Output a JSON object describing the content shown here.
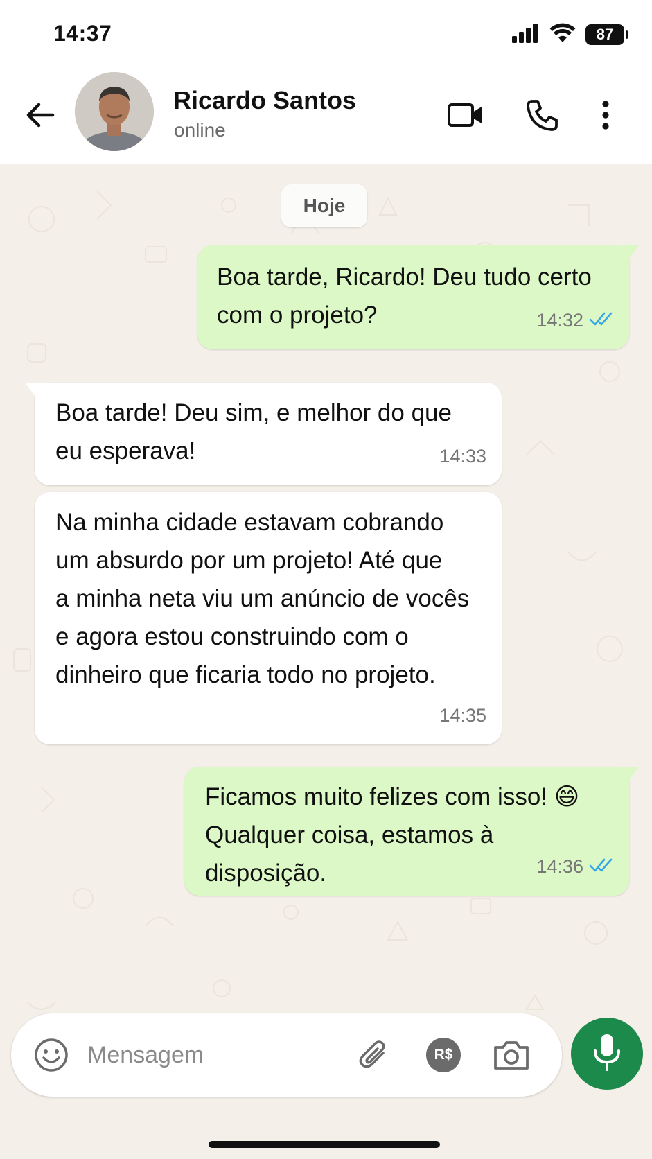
{
  "status_bar": {
    "time": "14:37",
    "battery": "87",
    "icons": [
      "signal-icon",
      "wifi-icon",
      "battery-icon"
    ]
  },
  "header": {
    "contact_name": "Ricardo Santos",
    "contact_status": "online",
    "icons": [
      "back-arrow-icon",
      "video-call-icon",
      "phone-icon",
      "more-options-icon"
    ]
  },
  "chat": {
    "date_label": "Hoje",
    "messages": [
      {
        "direction": "out",
        "text": "Boa tarde, Ricardo! Deu tudo certo\ncom o projeto?",
        "time": "14:32",
        "read": true
      },
      {
        "direction": "in",
        "text": "Boa tarde! Deu sim, e melhor do que\neu esperava!",
        "time": "14:33"
      },
      {
        "direction": "in",
        "text": "Na minha cidade estavam cobrando\num absurdo por um projeto! Até que\na minha neta viu um anúncio de vocês\ne agora estou construindo com o\ndinheiro que ficaria todo no projeto.",
        "time": "14:35"
      },
      {
        "direction": "out",
        "text": "Ficamos muito felizes com isso! 😄\nQualquer coisa, estamos à disposição.",
        "time": "14:36",
        "read": true
      }
    ]
  },
  "input": {
    "placeholder": "Mensagem",
    "payment_icon_label": "R$",
    "icons": [
      "emoji-icon",
      "attach-icon",
      "payment-icon",
      "camera-icon",
      "mic-icon"
    ]
  },
  "colors": {
    "outgoing_bubble": "#dcf8c6",
    "incoming_bubble": "#ffffff",
    "chat_background": "#f4efe8",
    "read_ticks": "#34a7e8",
    "mic_button": "#1b8a4a"
  }
}
